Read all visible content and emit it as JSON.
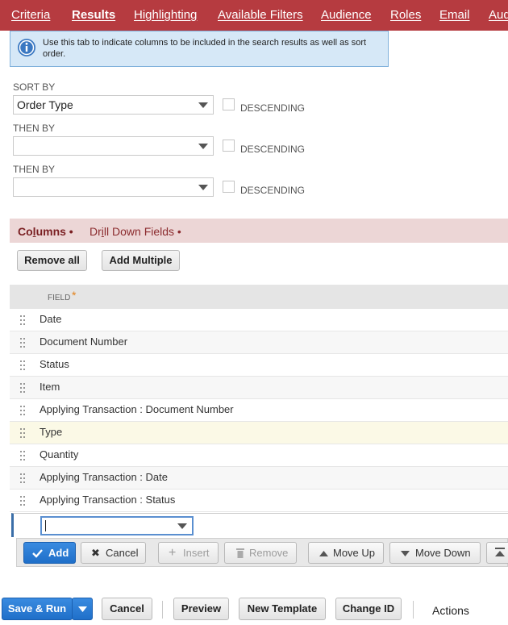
{
  "tabs": [
    {
      "label": "Criteria"
    },
    {
      "label": "Results"
    },
    {
      "label": "Highlighting"
    },
    {
      "label": "Available Filters"
    },
    {
      "label": "Audience"
    },
    {
      "label": "Roles"
    },
    {
      "label": "Email"
    },
    {
      "label": "Aud"
    }
  ],
  "info": {
    "text": "Use this tab to indicate columns to be included in the search results as well as sort order."
  },
  "sort": {
    "sort_by_label": "SORT BY",
    "sort_by_value": "Order Type",
    "then_by_label_1": "THEN BY",
    "then_by_value_1": "",
    "then_by_label_2": "THEN BY",
    "then_by_value_2": "",
    "descending_label": "DESCENDING"
  },
  "subtabs": {
    "columns_pre": "Co",
    "columns_u": "l",
    "columns_post": "umns •",
    "drill_pre": "Dr",
    "drill_u": "i",
    "drill_post": "ll Down Fields •"
  },
  "columns_buttons": {
    "remove_all": "Remove all",
    "add_multiple": "Add Multiple"
  },
  "grid": {
    "field_header": "FIELD",
    "required_mark": "*",
    "rows": [
      "Date",
      "Document Number",
      "Status",
      "Item",
      "Applying Transaction : Document Number",
      "Type",
      "Quantity",
      "Applying Transaction : Date",
      "Applying Transaction : Status"
    ],
    "edit_value": ""
  },
  "actionbar": {
    "add": "Add",
    "cancel": "Cancel",
    "insert": "Insert",
    "remove": "Remove",
    "move_up": "Move Up",
    "move_down": "Move Down"
  },
  "footer": {
    "save_run": "Save & Run",
    "cancel": "Cancel",
    "preview": "Preview",
    "new_template": "New Template",
    "change_id": "Change ID",
    "actions": "Actions"
  },
  "colors": {
    "tabbar": "#b63b40",
    "primary": "#2a7bd6",
    "subtab_bg": "#ecd6d6"
  }
}
